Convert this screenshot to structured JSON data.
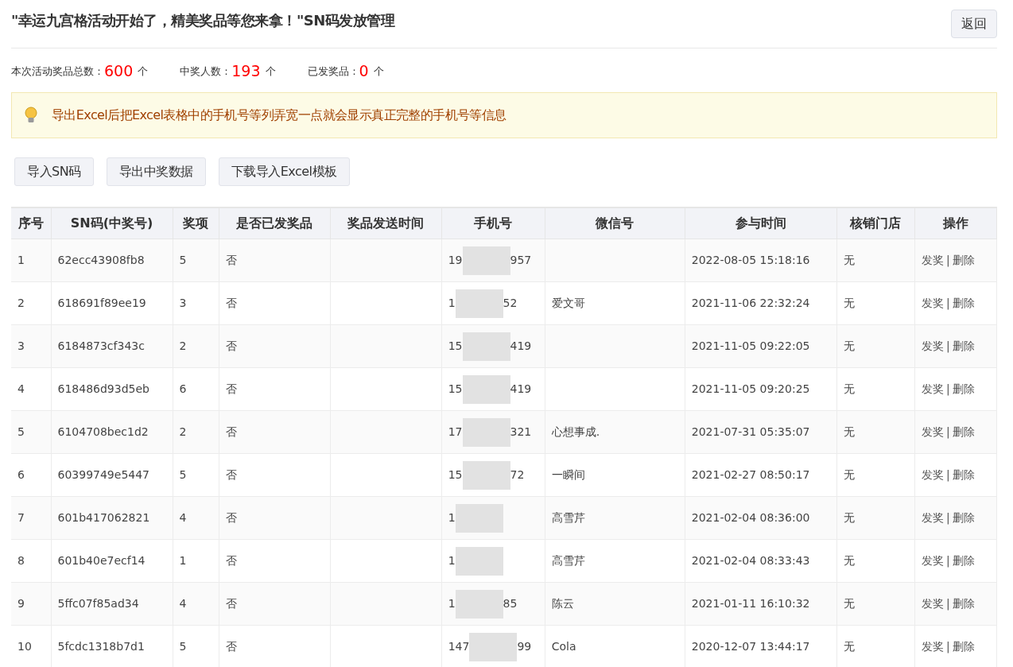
{
  "header": {
    "title": "\"幸运九宫格活动开始了，精美奖品等您来拿！\"SN码发放管理",
    "back_button": "返回"
  },
  "stats": [
    {
      "label": "本次活动奖品总数：",
      "value": "600",
      "unit": "个"
    },
    {
      "label": "中奖人数：",
      "value": "193",
      "unit": "个"
    },
    {
      "label": "已发奖品：",
      "value": "0",
      "unit": "个"
    }
  ],
  "notice": {
    "text": "导出Excel后把Excel表格中的手机号等列弄宽一点就会显示真正完整的手机号等信息"
  },
  "toolbar": [
    "导入SN码",
    "导出中奖数据",
    "下载导入Excel模板"
  ],
  "table": {
    "columns": [
      "序号",
      "SN码(中奖号)",
      "奖项",
      "是否已发奖品",
      "奖品发送时间",
      "手机号",
      "微信号",
      "参与时间",
      "核销门店",
      "操作"
    ],
    "rows": [
      {
        "index": "1",
        "sn": "62ecc43908fb8",
        "prize": "5",
        "sent": "否",
        "send_time": "",
        "phone_head": "19",
        "phone_tail": "957",
        "wechat": "",
        "join_time": "2022-08-05 15:18:16",
        "store": "无",
        "actions": [
          {
            "label": "发奖",
            "kind": "link"
          },
          {
            "label": "|",
            "kind": "separator"
          },
          {
            "label": "删除",
            "kind": "link"
          }
        ]
      },
      {
        "index": "2",
        "sn": "618691f89ee19",
        "prize": "3",
        "sent": "否",
        "send_time": "",
        "phone_head": "1",
        "phone_tail": "52",
        "wechat": "爱文哥",
        "join_time": "2021-11-06 22:32:24",
        "store": "无",
        "actions": [
          {
            "label": "发奖",
            "kind": "link"
          },
          {
            "label": "|",
            "kind": "separator"
          },
          {
            "label": "删除",
            "kind": "link"
          }
        ]
      },
      {
        "index": "3",
        "sn": "6184873cf343c",
        "prize": "2",
        "sent": "否",
        "send_time": "",
        "phone_head": "15",
        "phone_tail": "419",
        "wechat": "",
        "join_time": "2021-11-05 09:22:05",
        "store": "无",
        "actions": [
          {
            "label": "发奖",
            "kind": "link"
          },
          {
            "label": "|",
            "kind": "separator"
          },
          {
            "label": "删除",
            "kind": "link"
          }
        ]
      },
      {
        "index": "4",
        "sn": "618486d93d5eb",
        "prize": "6",
        "sent": "否",
        "send_time": "",
        "phone_head": "15",
        "phone_tail": "419",
        "wechat": "",
        "join_time": "2021-11-05 09:20:25",
        "store": "无",
        "actions": [
          {
            "label": "发奖",
            "kind": "link"
          },
          {
            "label": "|",
            "kind": "separator"
          },
          {
            "label": "删除",
            "kind": "link"
          }
        ]
      },
      {
        "index": "5",
        "sn": "6104708bec1d2",
        "prize": "2",
        "sent": "否",
        "send_time": "",
        "phone_head": "17",
        "phone_tail": "321",
        "wechat": "心想事成.",
        "join_time": "2021-07-31 05:35:07",
        "store": "无",
        "actions": [
          {
            "label": "发奖",
            "kind": "link"
          },
          {
            "label": "|",
            "kind": "separator"
          },
          {
            "label": "删除",
            "kind": "link"
          }
        ]
      },
      {
        "index": "6",
        "sn": "60399749e5447",
        "prize": "5",
        "sent": "否",
        "send_time": "",
        "phone_head": "15",
        "phone_tail": "72",
        "wechat": "一瞬间",
        "join_time": "2021-02-27 08:50:17",
        "store": "无",
        "actions": [
          {
            "label": "发奖",
            "kind": "link"
          },
          {
            "label": "|",
            "kind": "separator"
          },
          {
            "label": "删除",
            "kind": "link"
          }
        ]
      },
      {
        "index": "7",
        "sn": "601b417062821",
        "prize": "4",
        "sent": "否",
        "send_time": "",
        "phone_head": "1",
        "phone_tail": "",
        "wechat": "高雪芹",
        "join_time": "2021-02-04 08:36:00",
        "store": "无",
        "actions": [
          {
            "label": "发奖",
            "kind": "link"
          },
          {
            "label": "|",
            "kind": "separator"
          },
          {
            "label": "删除",
            "kind": "link"
          }
        ]
      },
      {
        "index": "8",
        "sn": "601b40e7ecf14",
        "prize": "1",
        "sent": "否",
        "send_time": "",
        "phone_head": "1",
        "phone_tail": "",
        "wechat": "高雪芹",
        "join_time": "2021-02-04 08:33:43",
        "store": "无",
        "actions": [
          {
            "label": "发奖",
            "kind": "link"
          },
          {
            "label": "|",
            "kind": "separator"
          },
          {
            "label": "删除",
            "kind": "link"
          }
        ]
      },
      {
        "index": "9",
        "sn": "5ffc07f85ad34",
        "prize": "4",
        "sent": "否",
        "send_time": "",
        "phone_head": "1",
        "phone_tail": "85",
        "wechat": "陈云",
        "join_time": "2021-01-11 16:10:32",
        "store": "无",
        "actions": [
          {
            "label": "发奖",
            "kind": "link"
          },
          {
            "label": "|",
            "kind": "separator"
          },
          {
            "label": "删除",
            "kind": "link"
          }
        ]
      },
      {
        "index": "10",
        "sn": "5fcdc1318b7d1",
        "prize": "5",
        "sent": "否",
        "send_time": "",
        "phone_head": "147",
        "phone_tail": "99",
        "wechat": "Cola",
        "join_time": "2020-12-07 13:44:17",
        "store": "无",
        "actions": [
          {
            "label": "发奖",
            "kind": "link"
          },
          {
            "label": "|",
            "kind": "separator"
          },
          {
            "label": "删除",
            "kind": "link"
          }
        ]
      }
    ]
  }
}
